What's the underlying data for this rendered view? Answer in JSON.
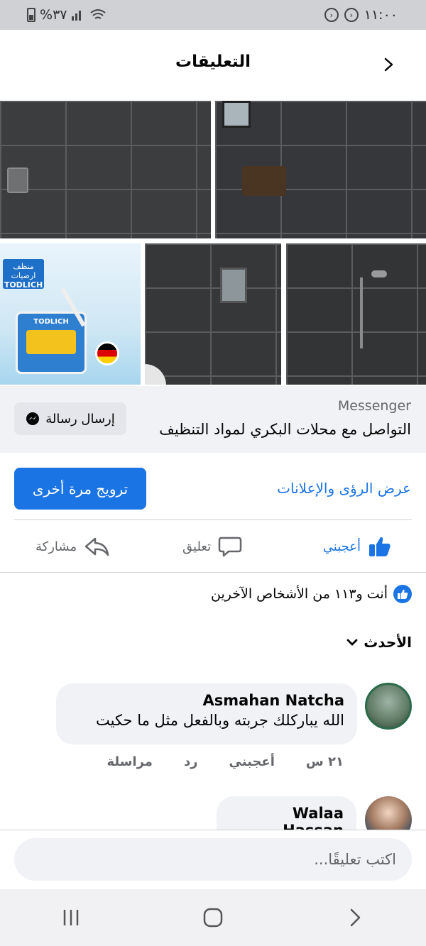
{
  "status_bar": {
    "battery": "%٣٧",
    "time": "١١:٠٠"
  },
  "header": {
    "title": "التعليقات"
  },
  "photos": {
    "product_brand_label": "منظف ارضيات",
    "product_brand": "TODLICH",
    "product_jug_label": "TODLICH"
  },
  "messenger": {
    "label": "Messenger",
    "text": "التواصل مع محلات البكري لمواد التنظيف",
    "button_label": "إرسال رسالة"
  },
  "promo": {
    "boost_label": "ترويج مرة أخرى",
    "insights_label": "عرض الرؤى والإعلانات"
  },
  "actions": {
    "like": "أعجبني",
    "comment": "تعليق",
    "share": "مشاركة"
  },
  "reactions": {
    "text": "أنت و١١٣ من الأشخاص الآخرين"
  },
  "sort": {
    "label": "الأحدث"
  },
  "comments": [
    {
      "name": "Asmahan Natcha",
      "text": "الله يباركلك جربته وبالفعل مثل ما حكيت",
      "time": "٢١ س",
      "like": "أعجبني",
      "reply": "رد",
      "message": "مراسلة"
    },
    {
      "name": "Walaa Hassan"
    }
  ],
  "composer": {
    "placeholder": "اكتب تعليقًا..."
  },
  "colors": {
    "accent": "#1b74e4",
    "surface": "#f0f2f5",
    "muted_text": "#65676b"
  }
}
